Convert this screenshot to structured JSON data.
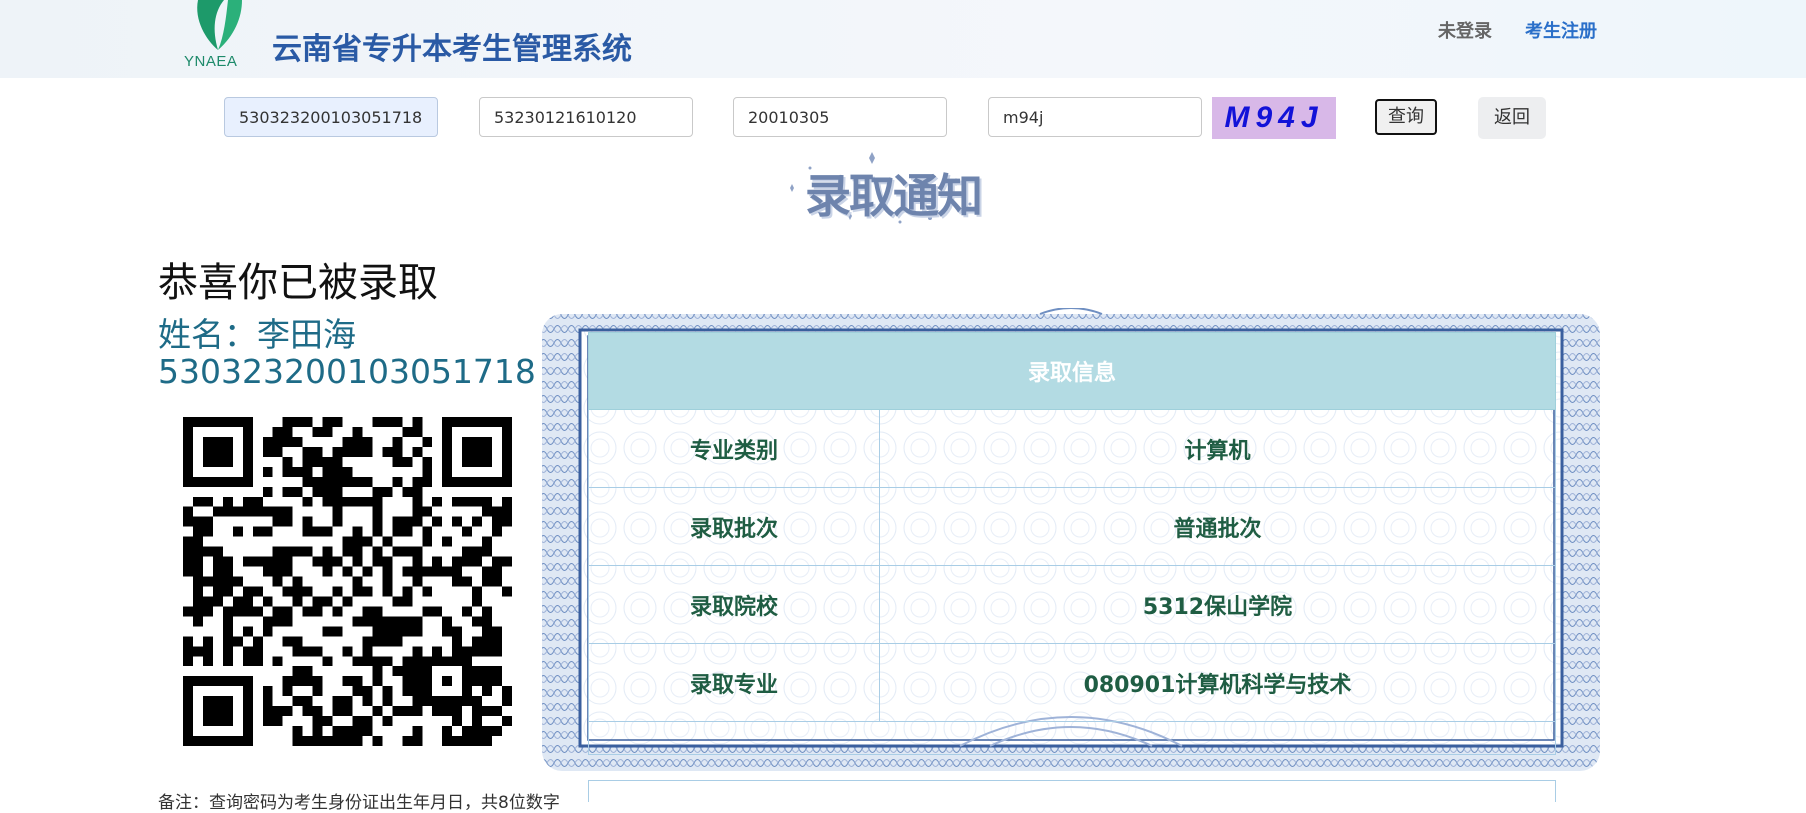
{
  "header": {
    "logo_text": "YNAEA",
    "title": "云南省专升本考生管理系统",
    "nav": {
      "status": "未登录",
      "register": "考生注册"
    }
  },
  "query": {
    "id_number": "530323200103051718",
    "exam_number": "53230121610120",
    "password": "20010305",
    "captcha_input": "m94j",
    "captcha_image_text": "M94J",
    "query_button": "查询",
    "back_button": "返回"
  },
  "notice": {
    "art_title": "录取通知",
    "congrats": "恭喜你已被录取",
    "name_line": "姓名：李田海",
    "id_line": "530323200103051718",
    "remark": "备注：查询密码为考生身份证出生年月日，共8位数字"
  },
  "admission": {
    "header": "录取信息",
    "rows": [
      {
        "label": "专业类别",
        "value": "计算机"
      },
      {
        "label": "录取批次",
        "value": "普通批次"
      },
      {
        "label": "录取院校",
        "value": "5312保山学院"
      },
      {
        "label": "录取专业",
        "value": "080901计算机科学与技术"
      }
    ]
  },
  "colors": {
    "title_blue": "#2a5aa5",
    "register_blue": "#2a6fc9",
    "table_header_bg": "#b3dbe3",
    "table_text_green": "#1f5d43",
    "name_teal": "#1e6b87",
    "captcha_bg": "#d8b8e8",
    "captcha_text": "#1212d8"
  }
}
